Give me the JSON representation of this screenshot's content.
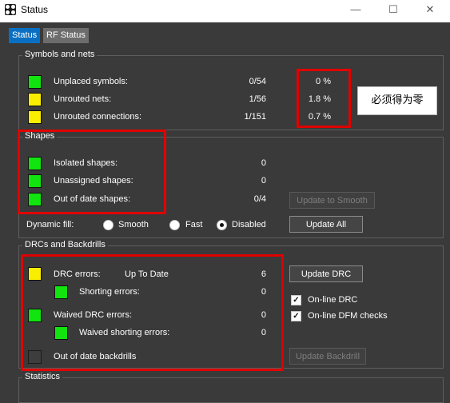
{
  "window": {
    "title": "Status",
    "minimize": "—",
    "maximize": "☐",
    "close": "✕"
  },
  "tabs": [
    "Status",
    "RF Status"
  ],
  "symbols_group": {
    "title": "Symbols and nets",
    "rows": [
      {
        "label": "Unplaced symbols:",
        "count": "0/54",
        "percent": "0 %",
        "status": "green"
      },
      {
        "label": "Unrouted nets:",
        "count": "1/56",
        "percent": "1.8 %",
        "status": "yellow"
      },
      {
        "label": "Unrouted connections:",
        "count": "1/151",
        "percent": "0.7 %",
        "status": "yellow"
      }
    ],
    "annotation": "必须得为零"
  },
  "shapes_group": {
    "title": "Shapes",
    "rows": [
      {
        "label": "Isolated shapes:",
        "value": "0",
        "status": "green"
      },
      {
        "label": "Unassigned shapes:",
        "value": "0",
        "status": "green"
      },
      {
        "label": "Out of date shapes:",
        "value": "0/4",
        "status": "green"
      }
    ],
    "update_smooth": "Update to Smooth",
    "dynamic_fill_label": "Dynamic fill:",
    "fill_options": [
      "Smooth",
      "Fast",
      "Disabled"
    ],
    "fill_selected": "Disabled",
    "update_all": "Update All"
  },
  "drc_group": {
    "title": "DRCs and Backdrills",
    "drc_label": "DRC errors:",
    "drc_status": "Up To Date",
    "drc_value": "6",
    "shorting_label": "Shorting errors:",
    "shorting_value": "0",
    "waived_label": "Waived DRC errors:",
    "waived_value": "0",
    "waived_shorting_label": "Waived shorting errors:",
    "waived_shorting_value": "0",
    "backdrills_label": "Out of date backdrills",
    "update_drc": "Update DRC",
    "online_drc": "On-line DRC",
    "online_dfm": "On-line DFM checks",
    "update_backdrill": "Update Backdrill"
  },
  "statistics_group": {
    "title": "Statistics"
  },
  "colors": {
    "green": "#11e40e",
    "yellow": "#f9ee00",
    "gray": "#3d3d3d",
    "accent": "#0a6fc2",
    "highlight": "#e00000"
  }
}
